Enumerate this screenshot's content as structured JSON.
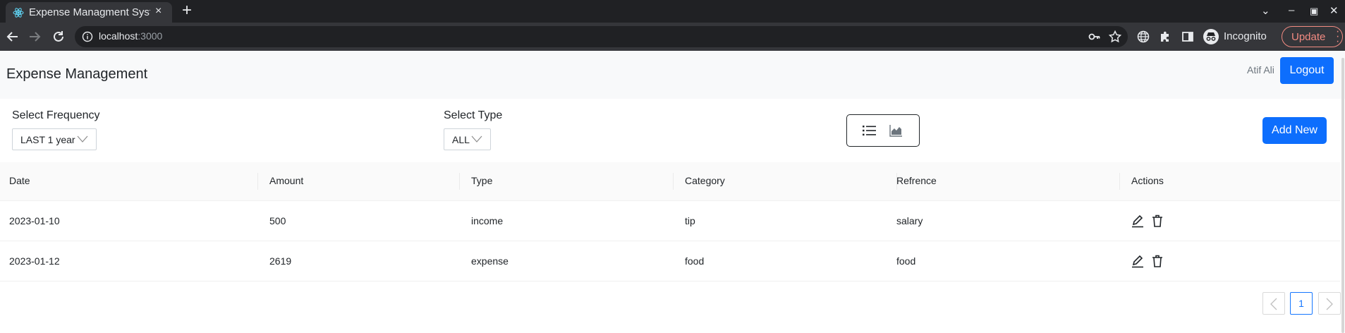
{
  "browser": {
    "tab_title": "Expense Managment System",
    "tab_close": "×",
    "new_tab": "+",
    "url_host": "localhost",
    "url_port": ":3000",
    "profile_label": "Incognito",
    "update_label": "Update",
    "window_controls": {
      "minimize": "–",
      "maximize": "▣",
      "close": "✕",
      "tab_search": "⌄"
    }
  },
  "icons": {
    "back": "arrow-left-icon",
    "forward": "arrow-right-icon",
    "reload": "reload-icon",
    "info": "info-icon",
    "key": "key-icon",
    "star": "star-icon",
    "translate": "globe-icon",
    "extensions": "puzzle-icon",
    "sidepanel": "side-panel-icon",
    "incognito": "incognito-icon",
    "menu": "more-vert-icon",
    "list_view": "list-icon",
    "chart_view": "area-chart-icon",
    "edit": "edit-icon",
    "delete": "delete-icon",
    "prev": "chevron-left-icon",
    "next": "chevron-right-icon"
  },
  "header": {
    "brand": "Expense Management",
    "username": "Atif Ali",
    "logout_label": "Logout"
  },
  "filters": {
    "frequency_label": "Select Frequency",
    "frequency_value": "LAST 1 year",
    "type_label": "Select Type",
    "type_value": "ALL",
    "add_new_label": "Add New"
  },
  "table": {
    "columns": [
      "Date",
      "Amount",
      "Type",
      "Category",
      "Refrence",
      "Actions"
    ],
    "rows": [
      {
        "date": "2023-01-10",
        "amount": "500",
        "type": "income",
        "category": "tip",
        "reference": "salary"
      },
      {
        "date": "2023-01-12",
        "amount": "2619",
        "type": "expense",
        "category": "food",
        "reference": "food"
      }
    ]
  },
  "pagination": {
    "current_page": "1"
  },
  "colors": {
    "primary": "#0d6efd",
    "chrome_dark": "#202124",
    "chrome_toolbar": "#35363a",
    "update_accent": "#f28b82",
    "header_bg": "#f8f9fa"
  }
}
